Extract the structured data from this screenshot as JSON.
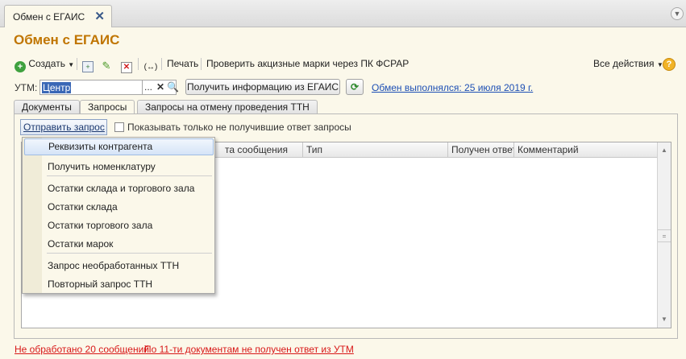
{
  "window_tab": {
    "title": "Обмен с ЕГАИС"
  },
  "page_title": "Обмен с ЕГАИС",
  "toolbar": {
    "create_label": "Создать",
    "print_label": "Печать",
    "check_marks_label": "Проверить акцизные марки через ПК ФСРАР",
    "all_actions_label": "Все действия"
  },
  "utm": {
    "label": "УТМ:",
    "value": "Центр",
    "get_info_label": "Получить информацию из ЕГАИС",
    "exchange_status": "Обмен выполнялся: 25 июля 2019 г."
  },
  "tabs": [
    {
      "label": "Документы"
    },
    {
      "label": "Запросы"
    },
    {
      "label": "Запросы на отмену проведения ТТН"
    }
  ],
  "requests": {
    "send_request_label": "Отправить запрос",
    "show_unanswered_label": "Показывать только не получившие ответ запросы"
  },
  "grid": {
    "columns": [
      "та сообщения",
      "Тип",
      "Получен ответ",
      "Комментарий"
    ]
  },
  "send_menu": {
    "items": [
      "Реквизиты контрагента",
      "Получить номенклатуру",
      "Остатки склада и торгового зала",
      "Остатки склада",
      "Остатки торгового зала",
      "Остатки марок",
      "Запрос необработанных ТТН",
      "Повторный запрос ТТН"
    ]
  },
  "status": {
    "unprocessed": "Не обработано 20 сообщений",
    "no_response": "По 11-ти документам не получен ответ из УТМ"
  },
  "colors": {
    "title": "#c07500",
    "link": "#1d4fb4",
    "warning": "#d81818",
    "background": "#fbf8ea"
  }
}
